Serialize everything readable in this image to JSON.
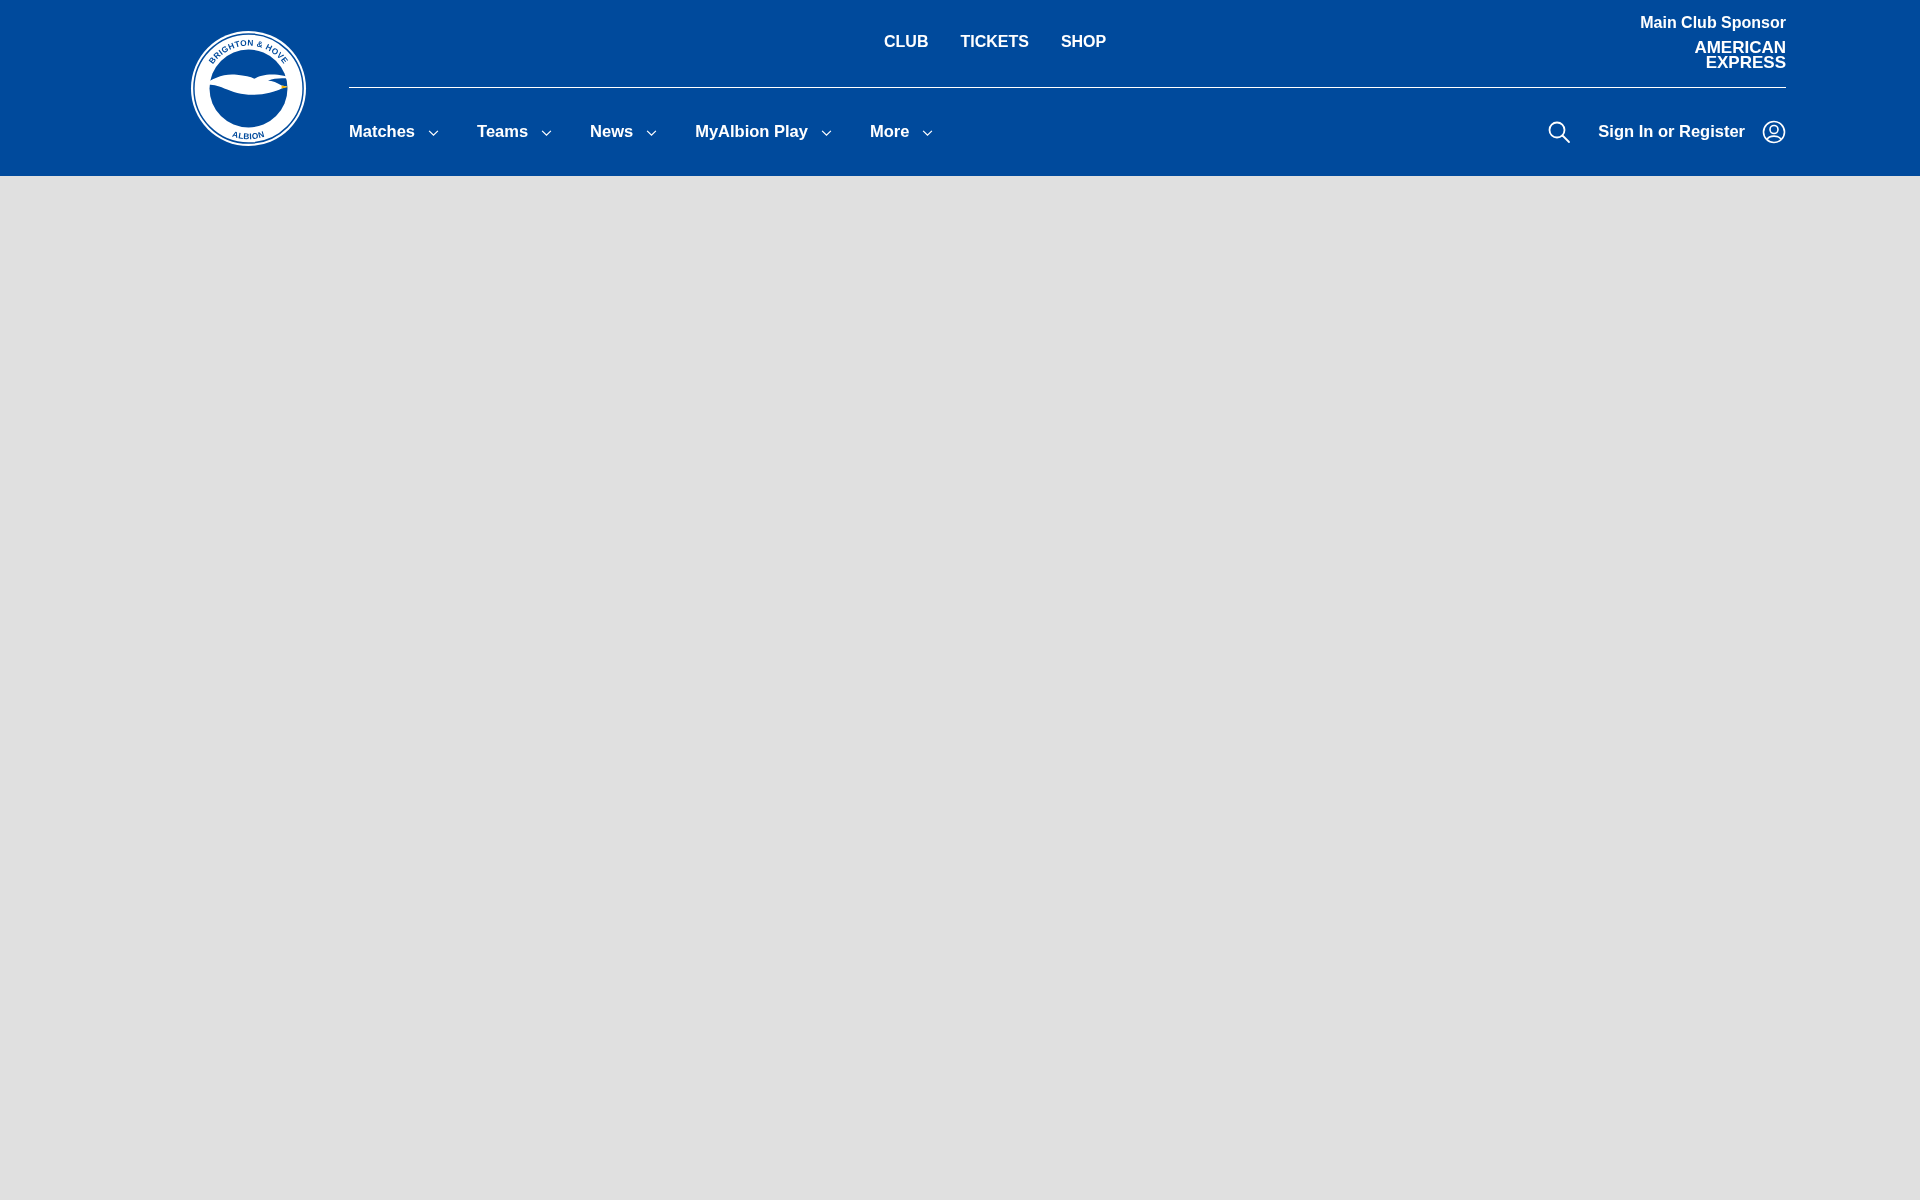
{
  "logo": {
    "top_text": "BRIGHTON & HOVE",
    "bottom_text": "ALBION"
  },
  "top_links": [
    "CLUB",
    "TICKETS",
    "SHOP"
  ],
  "sponsor": {
    "label": "Main Club Sponsor",
    "logo_lines": [
      "AMERICAN",
      "EXPRESS"
    ]
  },
  "nav": [
    {
      "label": "Matches",
      "expanded": false
    },
    {
      "label": "Teams",
      "expanded": false
    },
    {
      "label": "News",
      "expanded": false
    },
    {
      "label": "MyAlbion Play",
      "expanded": false
    },
    {
      "label": "More",
      "expanded": false
    }
  ],
  "account": {
    "label": "Sign In or Register"
  }
}
